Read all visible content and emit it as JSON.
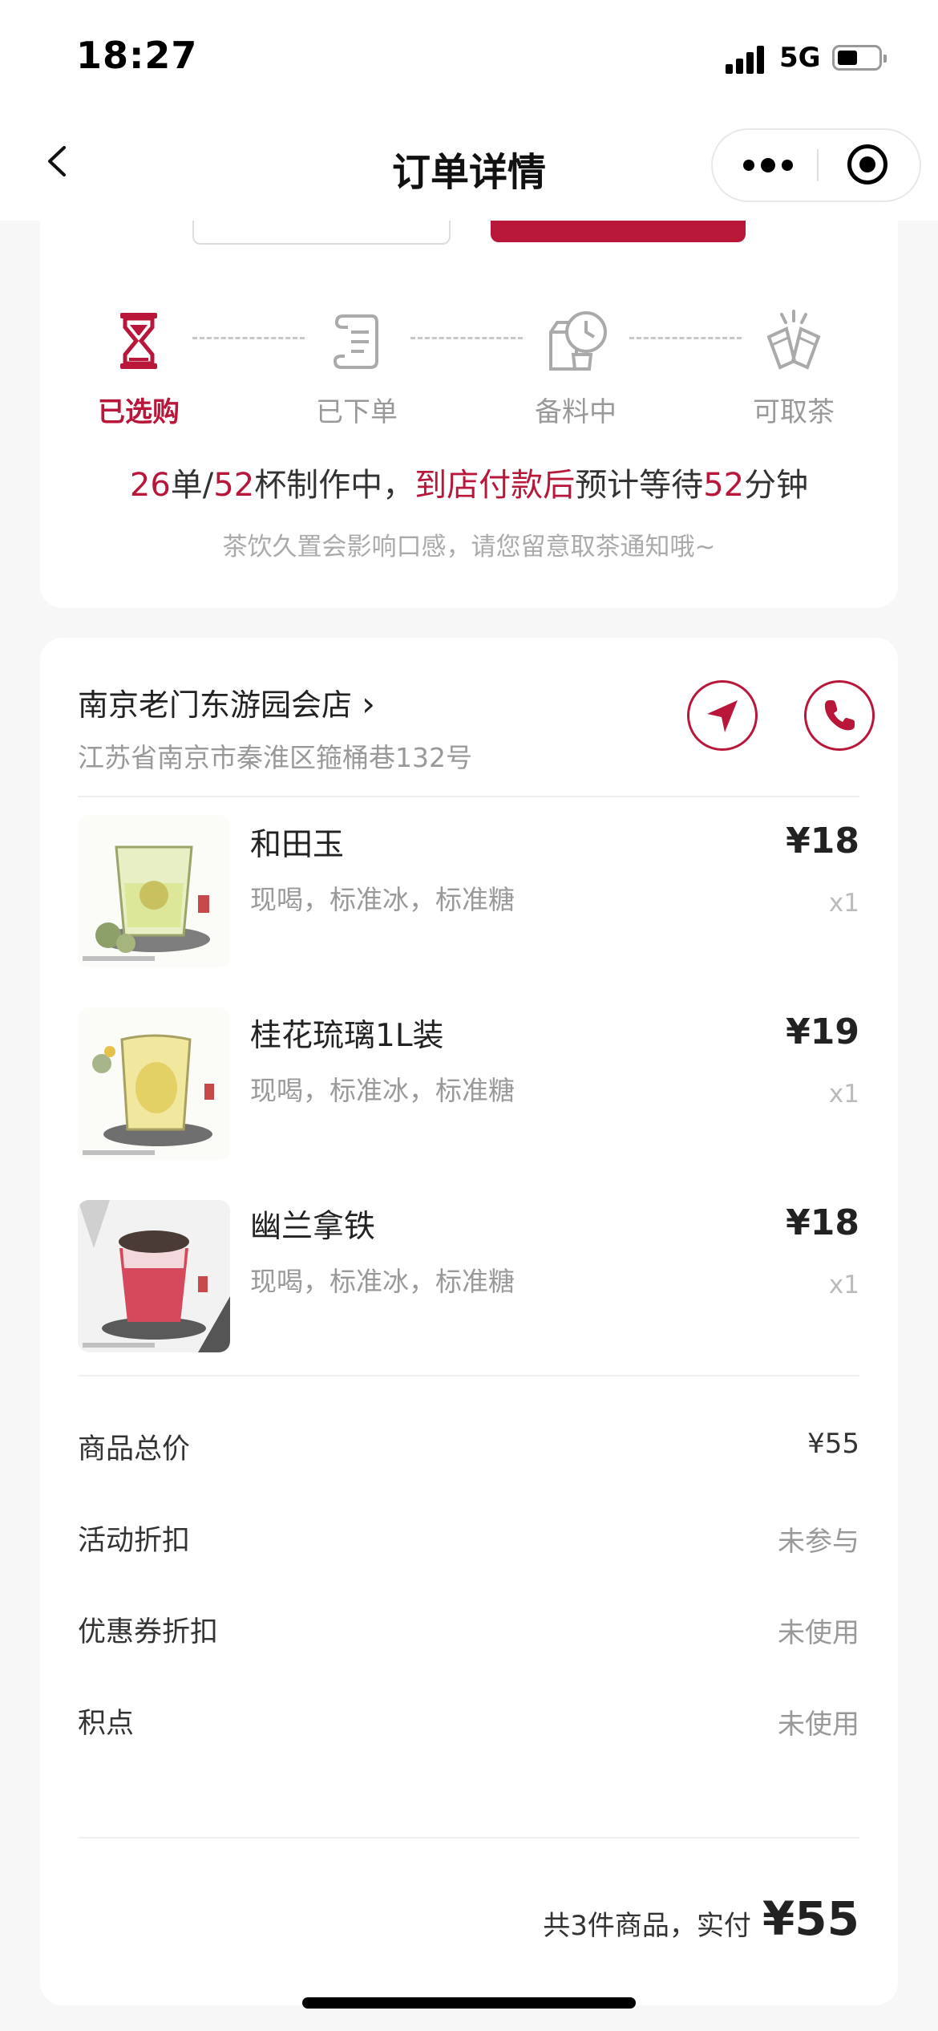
{
  "status": {
    "time": "18:27",
    "network": "5G"
  },
  "nav": {
    "title": "订单详情"
  },
  "steps": [
    {
      "label": "已选购",
      "icon": "hourglass-icon",
      "active": true
    },
    {
      "label": "已下单",
      "icon": "scroll-icon",
      "active": false
    },
    {
      "label": "备料中",
      "icon": "milk-clock-icon",
      "active": false
    },
    {
      "label": "可取茶",
      "icon": "cheers-cups-icon",
      "active": false
    }
  ],
  "progress": {
    "orders": "26",
    "orders_unit": "单/",
    "cups": "52",
    "cups_unit": "杯制作中，",
    "pay_note": "到店付款后",
    "wait_prefix": "预计等待",
    "minutes": "52",
    "minutes_unit": "分钟"
  },
  "hint": "茶饮久置会影响口感，请您留意取茶通知哦~",
  "store": {
    "name": "南京老门东游园会店",
    "chevron": "›",
    "address": "江苏省南京市秦淮区箍桶巷132号"
  },
  "items": [
    {
      "name": "和田玉",
      "spec": "现喝，标准冰，标准糖",
      "price": "¥18",
      "qty": "x1"
    },
    {
      "name": "桂花琉璃1L装",
      "spec": "现喝，标准冰，标准糖",
      "price": "¥19",
      "qty": "x1"
    },
    {
      "name": "幽兰拿铁",
      "spec": "现喝，标准冰，标准糖",
      "price": "¥18",
      "qty": "x1"
    }
  ],
  "summary": [
    {
      "label": "商品总价",
      "value": "¥55"
    },
    {
      "label": "活动折扣",
      "value": "未参与"
    },
    {
      "label": "优惠券折扣",
      "value": "未使用"
    },
    {
      "label": "积点",
      "value": "未使用"
    }
  ],
  "total": {
    "label": "共3件商品，实付",
    "amount": "¥55"
  },
  "colors": {
    "accent": "#b8173a",
    "muted": "#999999",
    "background": "#f7f7f7"
  }
}
